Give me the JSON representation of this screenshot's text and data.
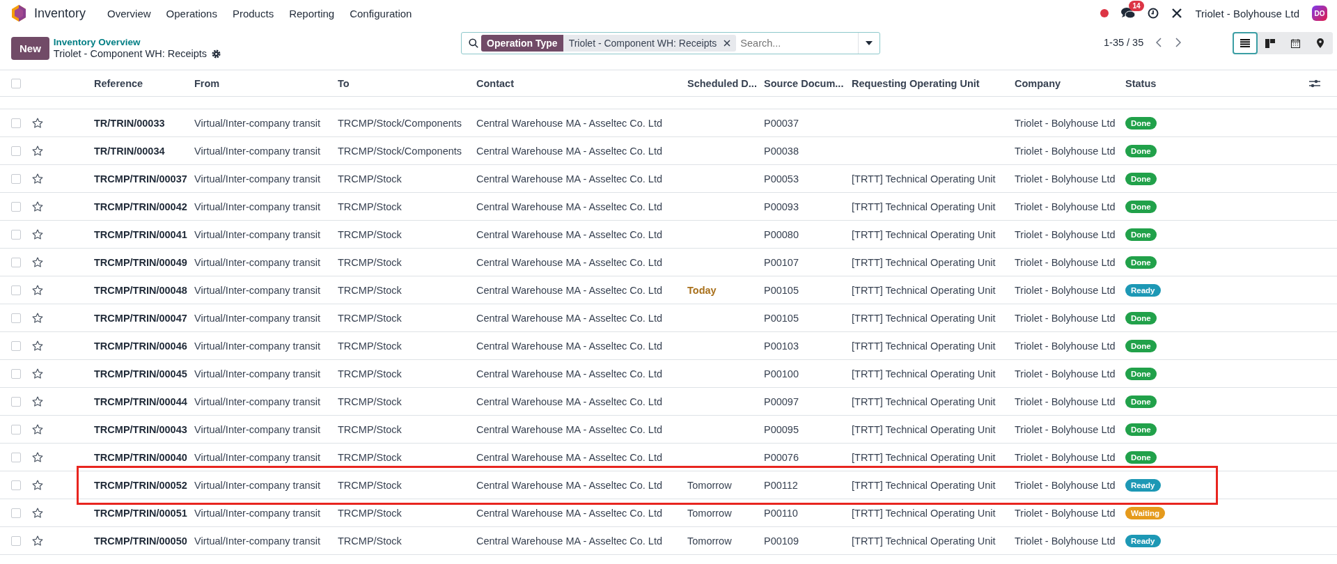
{
  "navbar": {
    "app_name": "Inventory",
    "menu": [
      "Overview",
      "Operations",
      "Products",
      "Reporting",
      "Configuration"
    ],
    "messages_badge": "14",
    "company": "Triolet - Bolyhouse Ltd",
    "avatar": "DO"
  },
  "control_panel": {
    "new_button": "New",
    "breadcrumb_parent": "Inventory Overview",
    "breadcrumb_current": "Triolet - Component WH: Receipts",
    "facet": {
      "label": "Operation Type",
      "value": "Triolet - Component WH: Receipts"
    },
    "search": {
      "placeholder": "Search..."
    },
    "pager": "1-35 / 35",
    "views": [
      {
        "kind": "list",
        "selected": true
      },
      {
        "kind": "kanban",
        "selected": false
      },
      {
        "kind": "calendar",
        "selected": false
      },
      {
        "kind": "map",
        "selected": false
      }
    ]
  },
  "table": {
    "select_all_checked": false,
    "columns": [
      "Reference",
      "From",
      "To",
      "Contact",
      "Scheduled D...",
      "Source Docum...",
      "Requesting Operating Unit",
      "Company",
      "Status"
    ],
    "rows": [
      {
        "checked": false,
        "reference": "TR/TRIN/00033",
        "from": "Virtual/Inter-company transit",
        "to": "TRCMP/Stock/Components",
        "contact": "Central Warehouse MA - Asseltec Co. Ltd",
        "source": "P00037",
        "company": "Triolet - Bolyhouse Ltd",
        "status": {
          "kind": "done",
          "label": "Done"
        },
        "highlighted": false
      },
      {
        "checked": false,
        "reference": "TR/TRIN/00034",
        "from": "Virtual/Inter-company transit",
        "to": "TRCMP/Stock/Components",
        "contact": "Central Warehouse MA - Asseltec Co. Ltd",
        "source": "P00038",
        "company": "Triolet - Bolyhouse Ltd",
        "status": {
          "kind": "done",
          "label": "Done"
        },
        "highlighted": false
      },
      {
        "checked": false,
        "reference": "TRCMP/TRIN/00037",
        "from": "Virtual/Inter-company transit",
        "to": "TRCMP/Stock",
        "contact": "Central Warehouse MA - Asseltec Co. Ltd",
        "source": "P00053",
        "unit": "[TRTT] Technical Operating Unit",
        "company": "Triolet - Bolyhouse Ltd",
        "status": {
          "kind": "done",
          "label": "Done"
        },
        "highlighted": false
      },
      {
        "checked": false,
        "reference": "TRCMP/TRIN/00042",
        "from": "Virtual/Inter-company transit",
        "to": "TRCMP/Stock",
        "contact": "Central Warehouse MA - Asseltec Co. Ltd",
        "source": "P00093",
        "unit": "[TRTT] Technical Operating Unit",
        "company": "Triolet - Bolyhouse Ltd",
        "status": {
          "kind": "done",
          "label": "Done"
        },
        "highlighted": false
      },
      {
        "checked": false,
        "reference": "TRCMP/TRIN/00041",
        "from": "Virtual/Inter-company transit",
        "to": "TRCMP/Stock",
        "contact": "Central Warehouse MA - Asseltec Co. Ltd",
        "source": "P00080",
        "unit": "[TRTT] Technical Operating Unit",
        "company": "Triolet - Bolyhouse Ltd",
        "status": {
          "kind": "done",
          "label": "Done"
        },
        "highlighted": false
      },
      {
        "checked": false,
        "reference": "TRCMP/TRIN/00049",
        "from": "Virtual/Inter-company transit",
        "to": "TRCMP/Stock",
        "contact": "Central Warehouse MA - Asseltec Co. Ltd",
        "source": "P00107",
        "unit": "[TRTT] Technical Operating Unit",
        "company": "Triolet - Bolyhouse Ltd",
        "status": {
          "kind": "done",
          "label": "Done"
        },
        "highlighted": false
      },
      {
        "checked": false,
        "reference": "TRCMP/TRIN/00048",
        "from": "Virtual/Inter-company transit",
        "to": "TRCMP/Stock",
        "contact": "Central Warehouse MA - Asseltec Co. Ltd",
        "scheduled": {
          "text": "Today",
          "due_today": true
        },
        "source": "P00105",
        "unit": "[TRTT] Technical Operating Unit",
        "company": "Triolet - Bolyhouse Ltd",
        "status": {
          "kind": "ready",
          "label": "Ready"
        },
        "highlighted": false
      },
      {
        "checked": false,
        "reference": "TRCMP/TRIN/00047",
        "from": "Virtual/Inter-company transit",
        "to": "TRCMP/Stock",
        "contact": "Central Warehouse MA - Asseltec Co. Ltd",
        "source": "P00105",
        "unit": "[TRTT] Technical Operating Unit",
        "company": "Triolet - Bolyhouse Ltd",
        "status": {
          "kind": "done",
          "label": "Done"
        },
        "highlighted": false
      },
      {
        "checked": false,
        "reference": "TRCMP/TRIN/00046",
        "from": "Virtual/Inter-company transit",
        "to": "TRCMP/Stock",
        "contact": "Central Warehouse MA - Asseltec Co. Ltd",
        "source": "P00103",
        "unit": "[TRTT] Technical Operating Unit",
        "company": "Triolet - Bolyhouse Ltd",
        "status": {
          "kind": "done",
          "label": "Done"
        },
        "highlighted": false
      },
      {
        "checked": false,
        "reference": "TRCMP/TRIN/00045",
        "from": "Virtual/Inter-company transit",
        "to": "TRCMP/Stock",
        "contact": "Central Warehouse MA - Asseltec Co. Ltd",
        "source": "P00100",
        "unit": "[TRTT] Technical Operating Unit",
        "company": "Triolet - Bolyhouse Ltd",
        "status": {
          "kind": "done",
          "label": "Done"
        },
        "highlighted": false
      },
      {
        "checked": false,
        "reference": "TRCMP/TRIN/00044",
        "from": "Virtual/Inter-company transit",
        "to": "TRCMP/Stock",
        "contact": "Central Warehouse MA - Asseltec Co. Ltd",
        "source": "P00097",
        "unit": "[TRTT] Technical Operating Unit",
        "company": "Triolet - Bolyhouse Ltd",
        "status": {
          "kind": "done",
          "label": "Done"
        },
        "highlighted": false
      },
      {
        "checked": false,
        "reference": "TRCMP/TRIN/00043",
        "from": "Virtual/Inter-company transit",
        "to": "TRCMP/Stock",
        "contact": "Central Warehouse MA - Asseltec Co. Ltd",
        "source": "P00095",
        "unit": "[TRTT] Technical Operating Unit",
        "company": "Triolet - Bolyhouse Ltd",
        "status": {
          "kind": "done",
          "label": "Done"
        },
        "highlighted": false
      },
      {
        "checked": false,
        "reference": "TRCMP/TRIN/00040",
        "from": "Virtual/Inter-company transit",
        "to": "TRCMP/Stock",
        "contact": "Central Warehouse MA - Asseltec Co. Ltd",
        "source": "P00076",
        "unit": "[TRTT] Technical Operating Unit",
        "company": "Triolet - Bolyhouse Ltd",
        "status": {
          "kind": "done",
          "label": "Done"
        },
        "highlighted": false
      },
      {
        "checked": false,
        "reference": "TRCMP/TRIN/00052",
        "from": "Virtual/Inter-company transit",
        "to": "TRCMP/Stock",
        "contact": "Central Warehouse MA - Asseltec Co. Ltd",
        "scheduled": {
          "text": "Tomorrow",
          "due_today": false
        },
        "source": "P00112",
        "unit": "[TRTT] Technical Operating Unit",
        "company": "Triolet - Bolyhouse Ltd",
        "status": {
          "kind": "ready",
          "label": "Ready"
        },
        "highlighted": true
      },
      {
        "checked": false,
        "reference": "TRCMP/TRIN/00051",
        "from": "Virtual/Inter-company transit",
        "to": "TRCMP/Stock",
        "contact": "Central Warehouse MA - Asseltec Co. Ltd",
        "scheduled": {
          "text": "Tomorrow",
          "due_today": false
        },
        "source": "P00110",
        "unit": "[TRTT] Technical Operating Unit",
        "company": "Triolet - Bolyhouse Ltd",
        "status": {
          "kind": "waiting",
          "label": "Waiting"
        },
        "highlighted": false
      },
      {
        "checked": false,
        "reference": "TRCMP/TRIN/00050",
        "from": "Virtual/Inter-company transit",
        "to": "TRCMP/Stock",
        "contact": "Central Warehouse MA - Asseltec Co. Ltd",
        "scheduled": {
          "text": "Tomorrow",
          "due_today": false
        },
        "source": "P00109",
        "unit": "[TRTT] Technical Operating Unit",
        "company": "Triolet - Bolyhouse Ltd",
        "status": {
          "kind": "ready",
          "label": "Ready"
        },
        "highlighted": false
      }
    ]
  }
}
